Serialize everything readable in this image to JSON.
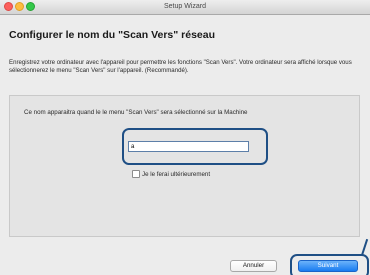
{
  "window": {
    "title": "Setup Wizard"
  },
  "page": {
    "title": "Configurer le nom du \"Scan Vers\" réseau",
    "description": "Enregistrez votre ordinateur avec l'appareil pour permettre les fonctions \"Scan Vers\". Votre ordinateur sera affiché lorsque vous sélectionnerez le menu \"Scan Vers\" sur l'appareil. (Recommandé)."
  },
  "panel": {
    "prompt": "Ce nom apparaitra quand le le menu \"Scan Vers\" sera sélectionné sur la Machine",
    "name_value": "a",
    "later_label": "Je le ferai ultérieurement"
  },
  "buttons": {
    "cancel_label": "Annuler",
    "next_label": "Suivant"
  },
  "colors": {
    "accent": "#1f4f85",
    "primary_button": "#197cf1",
    "window_background": "#ececec"
  }
}
